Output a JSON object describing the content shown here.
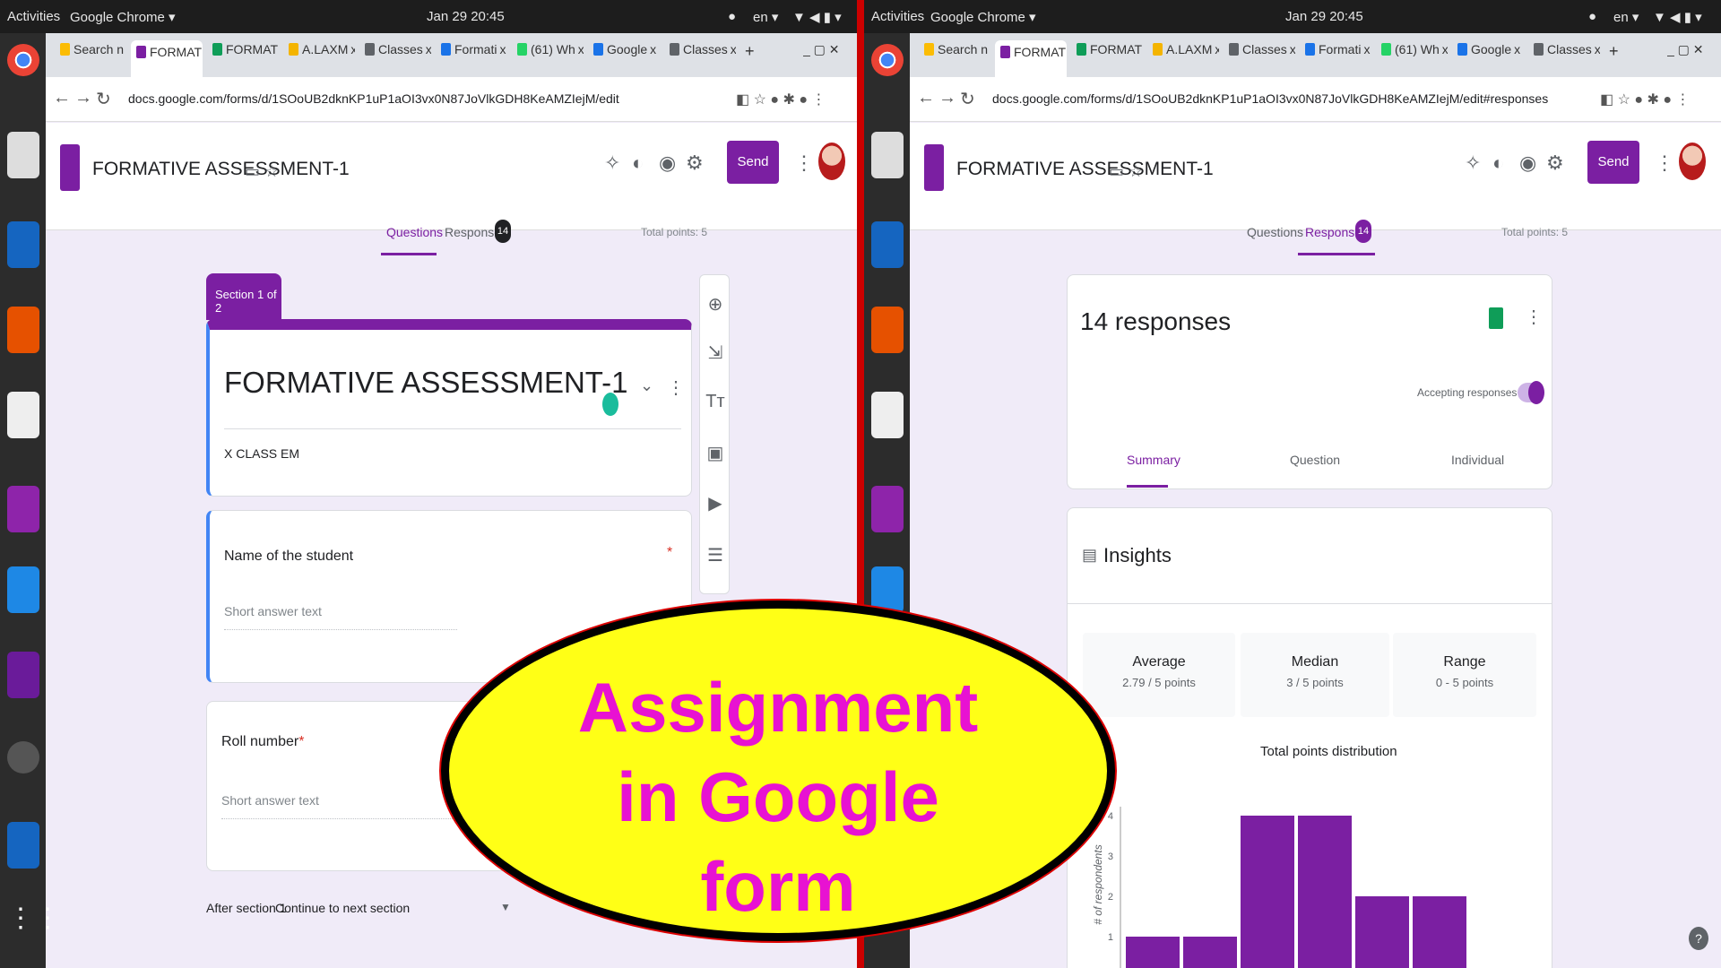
{
  "topbar": {
    "activities": "Activities",
    "app": "Google Chrome ▾",
    "clock": "Jan 29 20:45",
    "lang": "en ▾"
  },
  "tabs": [
    {
      "label": "Search n",
      "color": "#fbbc04"
    },
    {
      "label": "FORMAT",
      "color": "#7b1fa2"
    },
    {
      "label": "FORMAT",
      "color": "#0f9d58"
    },
    {
      "label": "A.LAXM",
      "color": "#f4b400"
    },
    {
      "label": "Classes",
      "color": "#5f6368"
    },
    {
      "label": "Formati",
      "color": "#1a73e8"
    },
    {
      "label": "(61) Wh",
      "color": "#25d366"
    },
    {
      "label": "Google",
      "color": "#1a73e8"
    },
    {
      "label": "Classes",
      "color": "#5f6368"
    }
  ],
  "tab_close": "x",
  "tab_new": "+",
  "left": {
    "url": "docs.google.com/forms/d/1SOoUB2dknKP1uP1aOI3vx0N87JoVlkGDH8KeAMZIejM/edit",
    "form_title": "FORMATIVE ASSESSMENT-1",
    "send": "Send",
    "tab_questions": "Questions",
    "tab_responses": "Responses",
    "response_count": "14",
    "total_points": "Total points: 5",
    "section_label": "Section 1 of 2",
    "card_title": "FORMATIVE ASSESSMENT-1",
    "card_desc": "X CLASS EM",
    "q1_label": "Name of the student",
    "q1_required": "*",
    "q1_placeholder": "Short answer text",
    "q2_label": "Roll number",
    "q2_required": "*",
    "q2_placeholder": "Short answer text",
    "after_section": "After section 1",
    "continue": "Continue to next section"
  },
  "right": {
    "url": "docs.google.com/forms/d/1SOoUB2dknKP1uP1aOI3vx0N87JoVlkGDH8KeAMZIejM/edit#responses",
    "form_title": "FORMATIVE ASSESSMENT-1",
    "send": "Send",
    "tab_questions": "Questions",
    "tab_responses": "Responses",
    "response_count": "14",
    "total_points": "Total points: 5",
    "responses_heading": "14 responses",
    "accepting": "Accepting responses",
    "sub_summary": "Summary",
    "sub_question": "Question",
    "sub_individual": "Individual",
    "insights": "Insights",
    "average_label": "Average",
    "average_value": "2.79 / 5 points",
    "median_label": "Median",
    "median_value": "3 / 5 points",
    "range_label": "Range",
    "range_value": "0 - 5 points",
    "chart_title": "Total points distribution",
    "y_label": "# of respondents"
  },
  "chart_data": {
    "type": "bar",
    "title": "Total points distribution",
    "ylabel": "# of respondents",
    "y_ticks": [
      "1",
      "2",
      "3",
      "4"
    ],
    "values": [
      1,
      1,
      4,
      4,
      2,
      2
    ],
    "ylim": [
      0,
      4
    ]
  },
  "overlay": {
    "line1": "Assignment",
    "line2": "in Google",
    "line3": "form"
  },
  "colors": {
    "accent": "#7b1fa2",
    "bg": "#f0ebf8",
    "overlay_fill": "#ffff16",
    "overlay_text": "#e812d2"
  }
}
